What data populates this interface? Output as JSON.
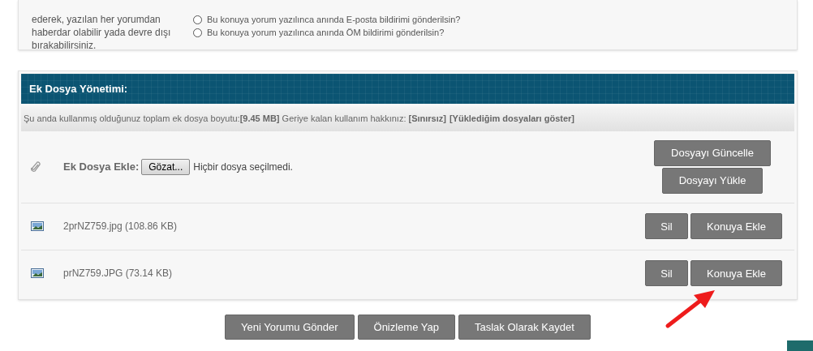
{
  "subscription": {
    "description_lines": [
      "ederek, yazılan her yorumdan",
      "haberdar olabilir yada devre dışı",
      "bırakabilirsiniz."
    ],
    "options": [
      {
        "label": "Bu konuya yorum yazılınca anında E-posta bildirimi gönderilsin?",
        "selected": false
      },
      {
        "label": "Bu konuya yorum yazılınca anında ÖM bildirimi gönderilsin?",
        "selected": false
      }
    ]
  },
  "attachments": {
    "title": "Ek Dosya Yönetimi:",
    "usage": "Şu anda kullanmış olduğunuz toplam ek dosya boyutu:**[9.45 MB]** Geriye kalan kullanım hakkınız: **[Sınırsız]**",
    "show_files_link": "[Yüklediğim dosyaları göster]",
    "upload": {
      "label": "Ek Dosya Ekle:",
      "browse_button": "Gözat...",
      "file_status": "Hiçbir dosya seçilmedi.",
      "buttons": [
        "Dosyayı Güncelle",
        "Dosyayı Yükle"
      ]
    },
    "files": [
      {
        "name": "2prNZ759.jpg (108.86 KB)",
        "delete": "Sil",
        "insert": "Konuya Ekle"
      },
      {
        "name": "prNZ759.JPG (73.14 KB)",
        "delete": "Sil",
        "insert": "Konuya Ekle"
      }
    ]
  },
  "actions": [
    "Yeni Yorumu Gönder",
    "Önizleme Yap",
    "Taslak Olarak Kaydet"
  ]
}
